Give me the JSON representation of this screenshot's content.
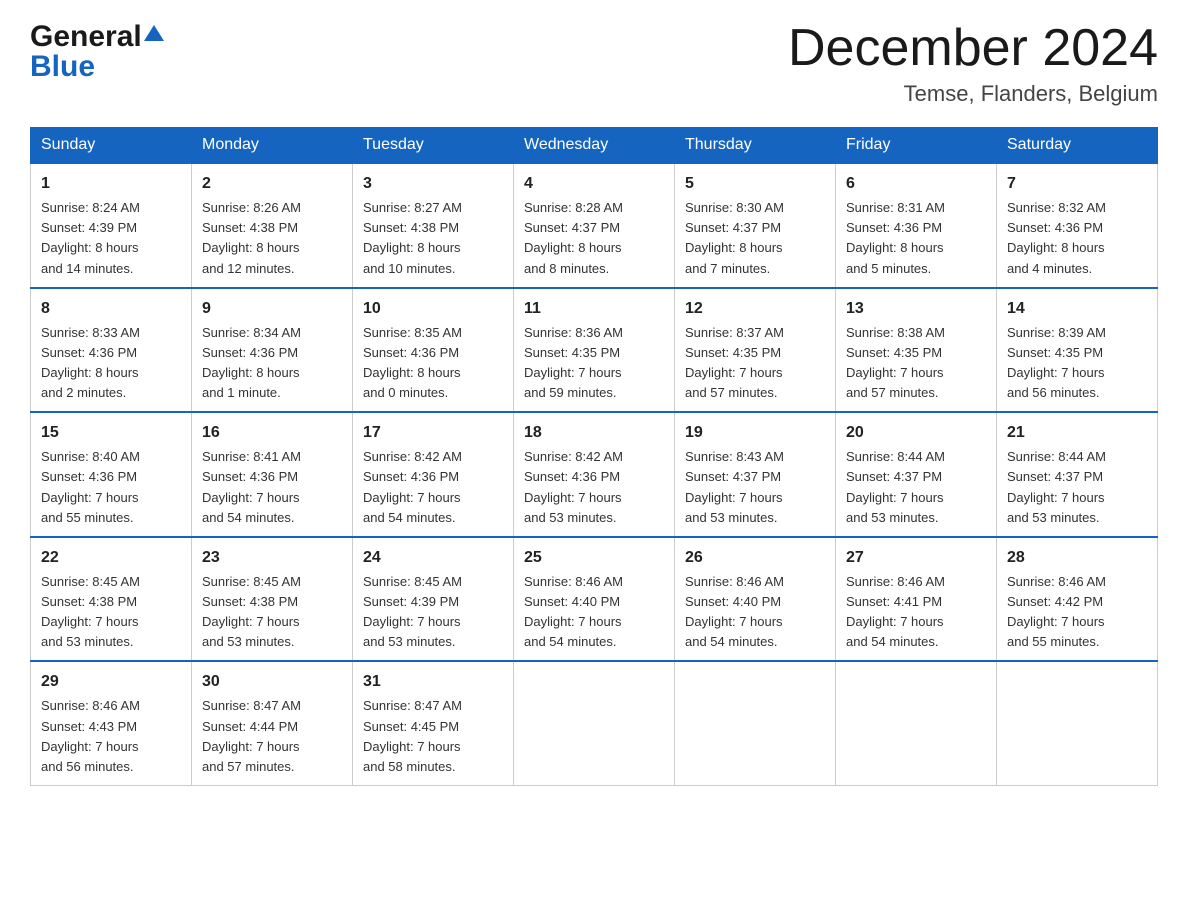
{
  "header": {
    "logo_general": "General",
    "logo_blue": "Blue",
    "month_title": "December 2024",
    "location": "Temse, Flanders, Belgium"
  },
  "weekdays": [
    "Sunday",
    "Monday",
    "Tuesday",
    "Wednesday",
    "Thursday",
    "Friday",
    "Saturday"
  ],
  "weeks": [
    [
      {
        "day": "1",
        "info": "Sunrise: 8:24 AM\nSunset: 4:39 PM\nDaylight: 8 hours\nand 14 minutes."
      },
      {
        "day": "2",
        "info": "Sunrise: 8:26 AM\nSunset: 4:38 PM\nDaylight: 8 hours\nand 12 minutes."
      },
      {
        "day": "3",
        "info": "Sunrise: 8:27 AM\nSunset: 4:38 PM\nDaylight: 8 hours\nand 10 minutes."
      },
      {
        "day": "4",
        "info": "Sunrise: 8:28 AM\nSunset: 4:37 PM\nDaylight: 8 hours\nand 8 minutes."
      },
      {
        "day": "5",
        "info": "Sunrise: 8:30 AM\nSunset: 4:37 PM\nDaylight: 8 hours\nand 7 minutes."
      },
      {
        "day": "6",
        "info": "Sunrise: 8:31 AM\nSunset: 4:36 PM\nDaylight: 8 hours\nand 5 minutes."
      },
      {
        "day": "7",
        "info": "Sunrise: 8:32 AM\nSunset: 4:36 PM\nDaylight: 8 hours\nand 4 minutes."
      }
    ],
    [
      {
        "day": "8",
        "info": "Sunrise: 8:33 AM\nSunset: 4:36 PM\nDaylight: 8 hours\nand 2 minutes."
      },
      {
        "day": "9",
        "info": "Sunrise: 8:34 AM\nSunset: 4:36 PM\nDaylight: 8 hours\nand 1 minute."
      },
      {
        "day": "10",
        "info": "Sunrise: 8:35 AM\nSunset: 4:36 PM\nDaylight: 8 hours\nand 0 minutes."
      },
      {
        "day": "11",
        "info": "Sunrise: 8:36 AM\nSunset: 4:35 PM\nDaylight: 7 hours\nand 59 minutes."
      },
      {
        "day": "12",
        "info": "Sunrise: 8:37 AM\nSunset: 4:35 PM\nDaylight: 7 hours\nand 57 minutes."
      },
      {
        "day": "13",
        "info": "Sunrise: 8:38 AM\nSunset: 4:35 PM\nDaylight: 7 hours\nand 57 minutes."
      },
      {
        "day": "14",
        "info": "Sunrise: 8:39 AM\nSunset: 4:35 PM\nDaylight: 7 hours\nand 56 minutes."
      }
    ],
    [
      {
        "day": "15",
        "info": "Sunrise: 8:40 AM\nSunset: 4:36 PM\nDaylight: 7 hours\nand 55 minutes."
      },
      {
        "day": "16",
        "info": "Sunrise: 8:41 AM\nSunset: 4:36 PM\nDaylight: 7 hours\nand 54 minutes."
      },
      {
        "day": "17",
        "info": "Sunrise: 8:42 AM\nSunset: 4:36 PM\nDaylight: 7 hours\nand 54 minutes."
      },
      {
        "day": "18",
        "info": "Sunrise: 8:42 AM\nSunset: 4:36 PM\nDaylight: 7 hours\nand 53 minutes."
      },
      {
        "day": "19",
        "info": "Sunrise: 8:43 AM\nSunset: 4:37 PM\nDaylight: 7 hours\nand 53 minutes."
      },
      {
        "day": "20",
        "info": "Sunrise: 8:44 AM\nSunset: 4:37 PM\nDaylight: 7 hours\nand 53 minutes."
      },
      {
        "day": "21",
        "info": "Sunrise: 8:44 AM\nSunset: 4:37 PM\nDaylight: 7 hours\nand 53 minutes."
      }
    ],
    [
      {
        "day": "22",
        "info": "Sunrise: 8:45 AM\nSunset: 4:38 PM\nDaylight: 7 hours\nand 53 minutes."
      },
      {
        "day": "23",
        "info": "Sunrise: 8:45 AM\nSunset: 4:38 PM\nDaylight: 7 hours\nand 53 minutes."
      },
      {
        "day": "24",
        "info": "Sunrise: 8:45 AM\nSunset: 4:39 PM\nDaylight: 7 hours\nand 53 minutes."
      },
      {
        "day": "25",
        "info": "Sunrise: 8:46 AM\nSunset: 4:40 PM\nDaylight: 7 hours\nand 54 minutes."
      },
      {
        "day": "26",
        "info": "Sunrise: 8:46 AM\nSunset: 4:40 PM\nDaylight: 7 hours\nand 54 minutes."
      },
      {
        "day": "27",
        "info": "Sunrise: 8:46 AM\nSunset: 4:41 PM\nDaylight: 7 hours\nand 54 minutes."
      },
      {
        "day": "28",
        "info": "Sunrise: 8:46 AM\nSunset: 4:42 PM\nDaylight: 7 hours\nand 55 minutes."
      }
    ],
    [
      {
        "day": "29",
        "info": "Sunrise: 8:46 AM\nSunset: 4:43 PM\nDaylight: 7 hours\nand 56 minutes."
      },
      {
        "day": "30",
        "info": "Sunrise: 8:47 AM\nSunset: 4:44 PM\nDaylight: 7 hours\nand 57 minutes."
      },
      {
        "day": "31",
        "info": "Sunrise: 8:47 AM\nSunset: 4:45 PM\nDaylight: 7 hours\nand 58 minutes."
      },
      {
        "day": "",
        "info": ""
      },
      {
        "day": "",
        "info": ""
      },
      {
        "day": "",
        "info": ""
      },
      {
        "day": "",
        "info": ""
      }
    ]
  ]
}
